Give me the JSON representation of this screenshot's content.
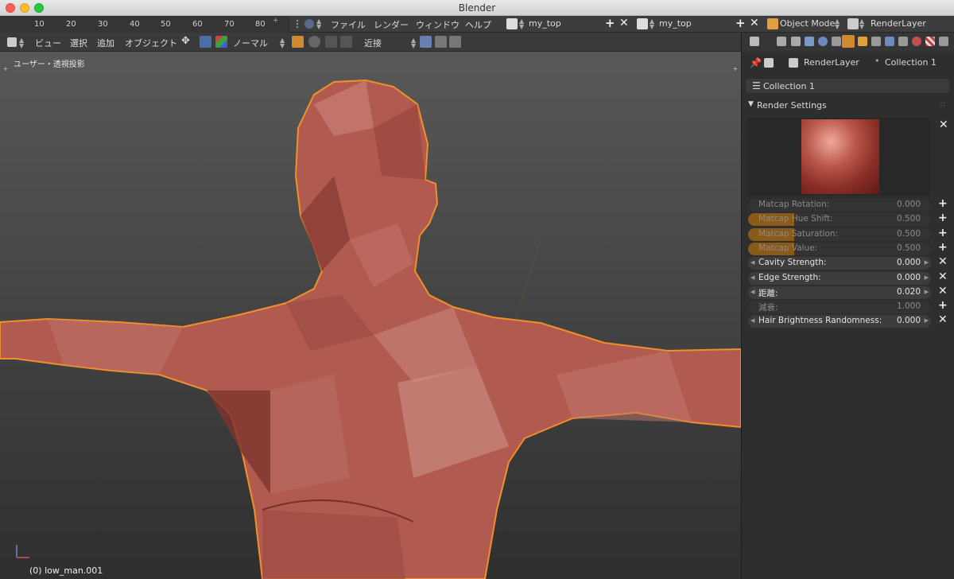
{
  "window": {
    "title": "Blender"
  },
  "timeline": {
    "ticks": [
      "10",
      "20",
      "30",
      "40",
      "50",
      "60",
      "70",
      "80"
    ]
  },
  "topmenu": {
    "items": [
      "ファイル",
      "レンダー",
      "ウィンドウ",
      "ヘルプ"
    ],
    "workspace_left": "my_top",
    "workspace_right": "my_top",
    "mode": "Object Mode",
    "render_layer": "RenderLayer"
  },
  "viewport_header": {
    "menus": [
      "ビュー",
      "選択",
      "追加",
      "オブジェクト"
    ],
    "orientation": "ノーマル",
    "snap": "近接"
  },
  "viewport": {
    "view_label": "ユーザー・透視投影",
    "object_label": "(0) low_man.001",
    "mesh_color": "#b45a4f",
    "outline_color": "#f0902a"
  },
  "properties": {
    "context_render_layer": "RenderLayer",
    "context_collection": "Collection 1",
    "collection_bar": "Collection 1",
    "section_title": "Render Settings",
    "rows": [
      {
        "label": "Matcap Rotation:",
        "value": "0.000",
        "disabled": true,
        "fill": 0.0,
        "action": "+"
      },
      {
        "label": "Matcap Hue Shift:",
        "value": "0.500",
        "disabled": true,
        "fill": 0.5,
        "action": "+"
      },
      {
        "label": "Matcap Saturation:",
        "value": "0.500",
        "disabled": true,
        "fill": 0.5,
        "action": "+"
      },
      {
        "label": "Matcap Value:",
        "value": "0.500",
        "disabled": true,
        "fill": 0.5,
        "action": "+"
      },
      {
        "label": "Cavity Strength:",
        "value": "0.000",
        "disabled": false,
        "fill": 0,
        "action": "✕"
      },
      {
        "label": "Edge Strength:",
        "value": "0.000",
        "disabled": false,
        "fill": 0,
        "action": "✕"
      },
      {
        "label": "距離:",
        "value": "0.020",
        "disabled": false,
        "fill": 0,
        "action": "✕"
      },
      {
        "label": "減衰:",
        "value": "1.000",
        "disabled": true,
        "fill": 0,
        "action": "+"
      },
      {
        "label": "Hair Brightness Randomness:",
        "value": "0.000",
        "disabled": false,
        "fill": 0,
        "action": "✕"
      }
    ]
  }
}
